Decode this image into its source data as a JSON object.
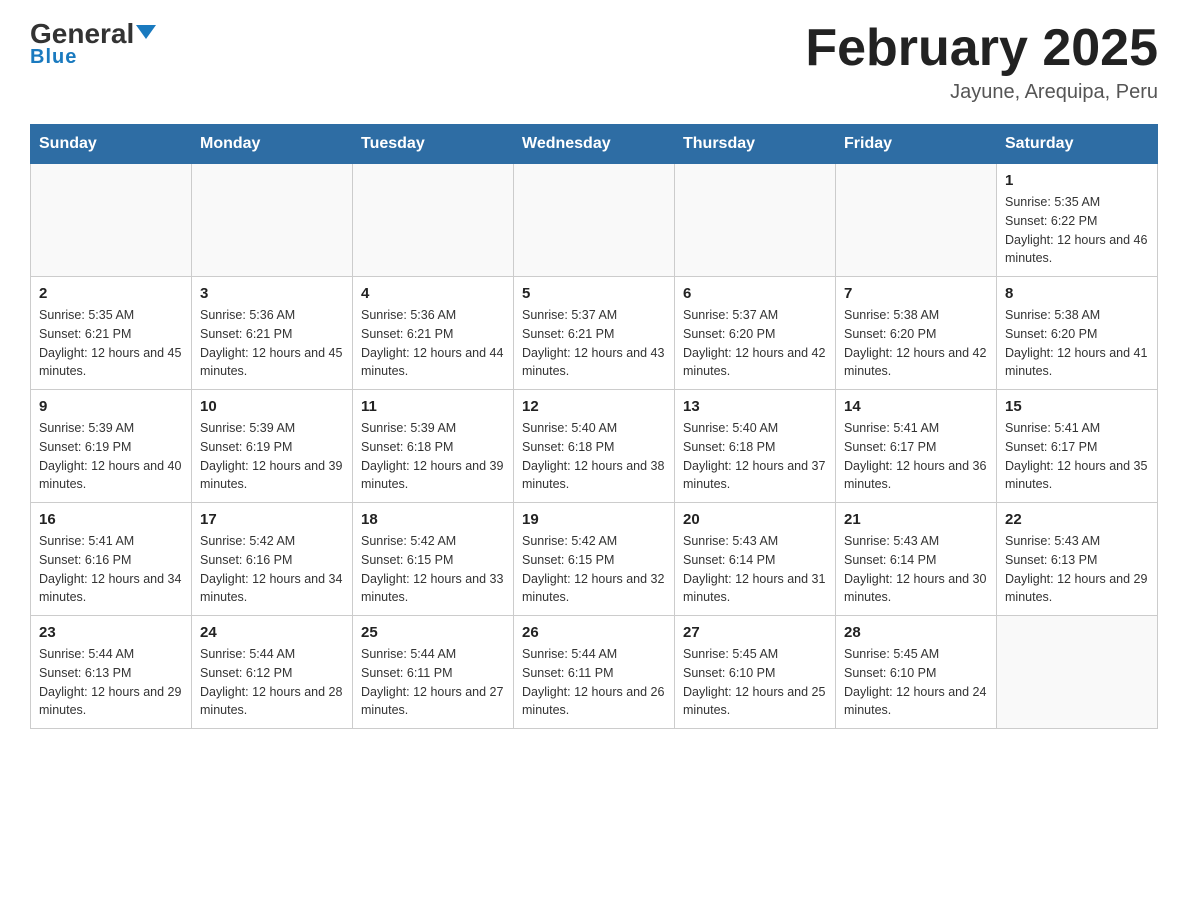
{
  "header": {
    "logo_general": "General",
    "logo_blue": "Blue",
    "month_title": "February 2025",
    "location": "Jayune, Arequipa, Peru"
  },
  "days_of_week": [
    "Sunday",
    "Monday",
    "Tuesday",
    "Wednesday",
    "Thursday",
    "Friday",
    "Saturday"
  ],
  "weeks": [
    [
      {
        "day": "",
        "info": ""
      },
      {
        "day": "",
        "info": ""
      },
      {
        "day": "",
        "info": ""
      },
      {
        "day": "",
        "info": ""
      },
      {
        "day": "",
        "info": ""
      },
      {
        "day": "",
        "info": ""
      },
      {
        "day": "1",
        "info": "Sunrise: 5:35 AM\nSunset: 6:22 PM\nDaylight: 12 hours and 46 minutes."
      }
    ],
    [
      {
        "day": "2",
        "info": "Sunrise: 5:35 AM\nSunset: 6:21 PM\nDaylight: 12 hours and 45 minutes."
      },
      {
        "day": "3",
        "info": "Sunrise: 5:36 AM\nSunset: 6:21 PM\nDaylight: 12 hours and 45 minutes."
      },
      {
        "day": "4",
        "info": "Sunrise: 5:36 AM\nSunset: 6:21 PM\nDaylight: 12 hours and 44 minutes."
      },
      {
        "day": "5",
        "info": "Sunrise: 5:37 AM\nSunset: 6:21 PM\nDaylight: 12 hours and 43 minutes."
      },
      {
        "day": "6",
        "info": "Sunrise: 5:37 AM\nSunset: 6:20 PM\nDaylight: 12 hours and 42 minutes."
      },
      {
        "day": "7",
        "info": "Sunrise: 5:38 AM\nSunset: 6:20 PM\nDaylight: 12 hours and 42 minutes."
      },
      {
        "day": "8",
        "info": "Sunrise: 5:38 AM\nSunset: 6:20 PM\nDaylight: 12 hours and 41 minutes."
      }
    ],
    [
      {
        "day": "9",
        "info": "Sunrise: 5:39 AM\nSunset: 6:19 PM\nDaylight: 12 hours and 40 minutes."
      },
      {
        "day": "10",
        "info": "Sunrise: 5:39 AM\nSunset: 6:19 PM\nDaylight: 12 hours and 39 minutes."
      },
      {
        "day": "11",
        "info": "Sunrise: 5:39 AM\nSunset: 6:18 PM\nDaylight: 12 hours and 39 minutes."
      },
      {
        "day": "12",
        "info": "Sunrise: 5:40 AM\nSunset: 6:18 PM\nDaylight: 12 hours and 38 minutes."
      },
      {
        "day": "13",
        "info": "Sunrise: 5:40 AM\nSunset: 6:18 PM\nDaylight: 12 hours and 37 minutes."
      },
      {
        "day": "14",
        "info": "Sunrise: 5:41 AM\nSunset: 6:17 PM\nDaylight: 12 hours and 36 minutes."
      },
      {
        "day": "15",
        "info": "Sunrise: 5:41 AM\nSunset: 6:17 PM\nDaylight: 12 hours and 35 minutes."
      }
    ],
    [
      {
        "day": "16",
        "info": "Sunrise: 5:41 AM\nSunset: 6:16 PM\nDaylight: 12 hours and 34 minutes."
      },
      {
        "day": "17",
        "info": "Sunrise: 5:42 AM\nSunset: 6:16 PM\nDaylight: 12 hours and 34 minutes."
      },
      {
        "day": "18",
        "info": "Sunrise: 5:42 AM\nSunset: 6:15 PM\nDaylight: 12 hours and 33 minutes."
      },
      {
        "day": "19",
        "info": "Sunrise: 5:42 AM\nSunset: 6:15 PM\nDaylight: 12 hours and 32 minutes."
      },
      {
        "day": "20",
        "info": "Sunrise: 5:43 AM\nSunset: 6:14 PM\nDaylight: 12 hours and 31 minutes."
      },
      {
        "day": "21",
        "info": "Sunrise: 5:43 AM\nSunset: 6:14 PM\nDaylight: 12 hours and 30 minutes."
      },
      {
        "day": "22",
        "info": "Sunrise: 5:43 AM\nSunset: 6:13 PM\nDaylight: 12 hours and 29 minutes."
      }
    ],
    [
      {
        "day": "23",
        "info": "Sunrise: 5:44 AM\nSunset: 6:13 PM\nDaylight: 12 hours and 29 minutes."
      },
      {
        "day": "24",
        "info": "Sunrise: 5:44 AM\nSunset: 6:12 PM\nDaylight: 12 hours and 28 minutes."
      },
      {
        "day": "25",
        "info": "Sunrise: 5:44 AM\nSunset: 6:11 PM\nDaylight: 12 hours and 27 minutes."
      },
      {
        "day": "26",
        "info": "Sunrise: 5:44 AM\nSunset: 6:11 PM\nDaylight: 12 hours and 26 minutes."
      },
      {
        "day": "27",
        "info": "Sunrise: 5:45 AM\nSunset: 6:10 PM\nDaylight: 12 hours and 25 minutes."
      },
      {
        "day": "28",
        "info": "Sunrise: 5:45 AM\nSunset: 6:10 PM\nDaylight: 12 hours and 24 minutes."
      },
      {
        "day": "",
        "info": ""
      }
    ]
  ]
}
